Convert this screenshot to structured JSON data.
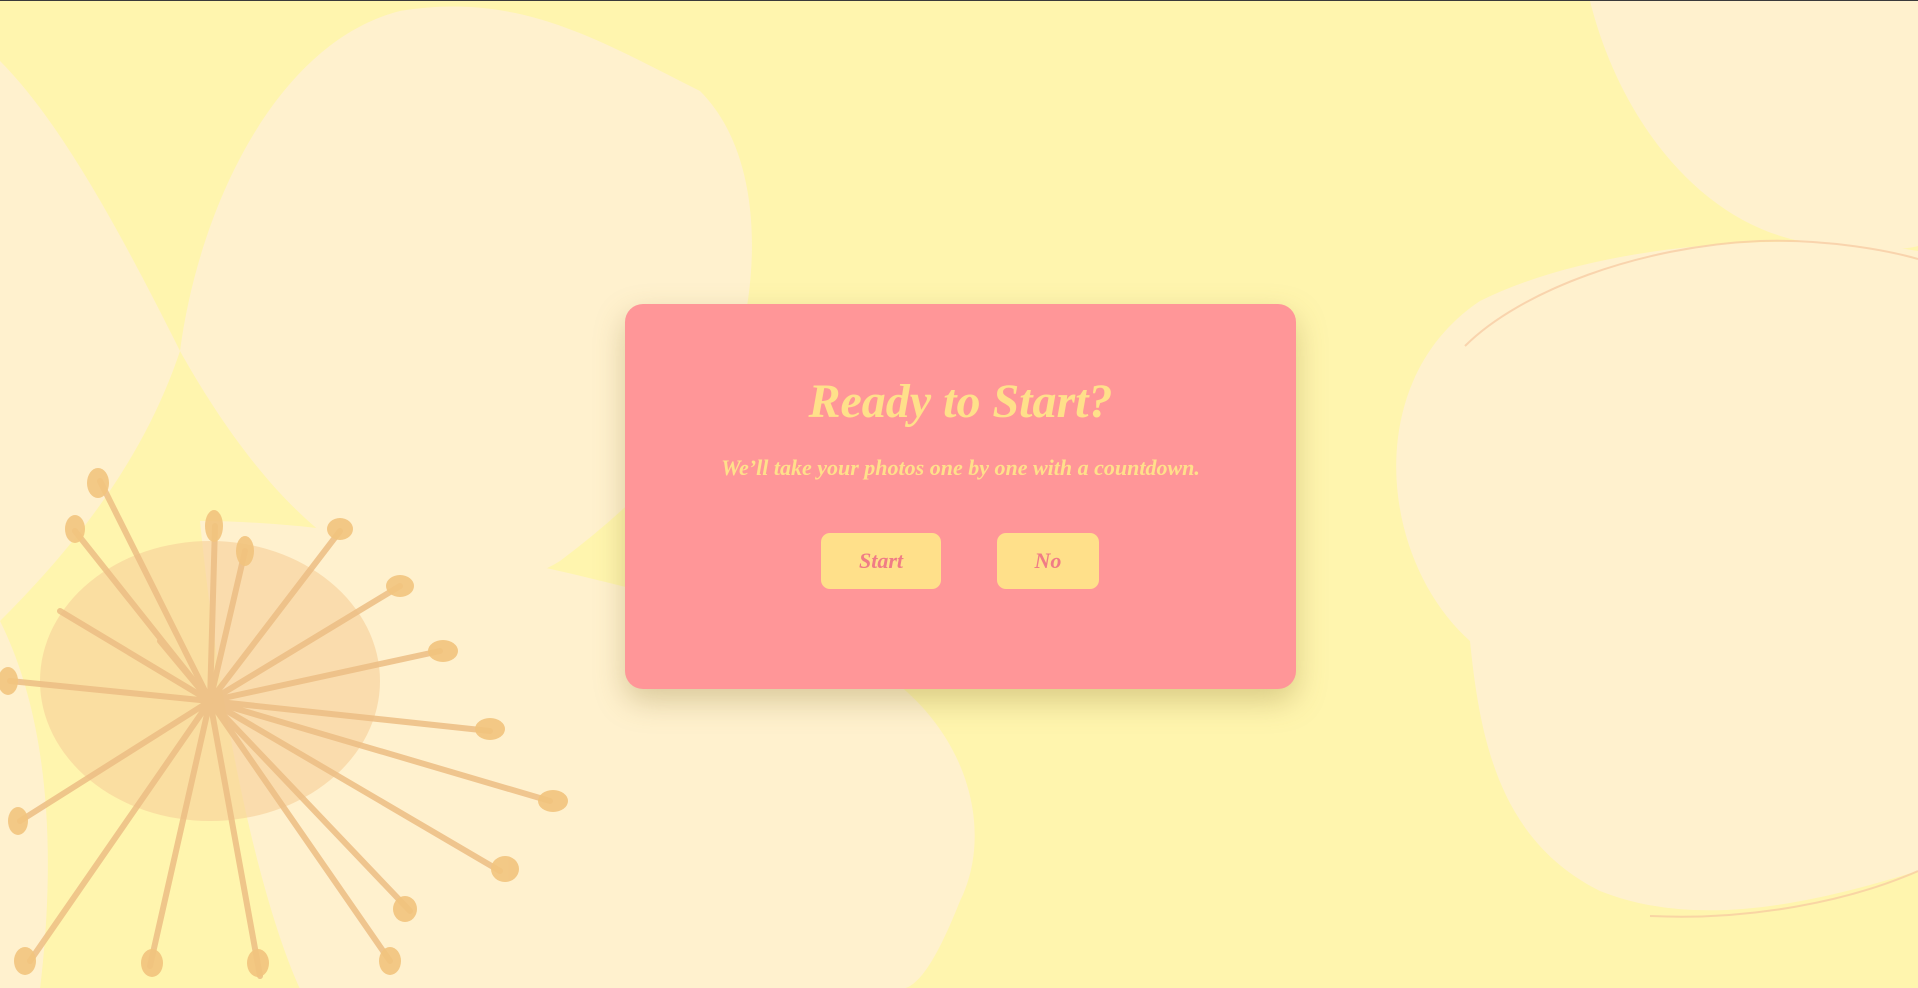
{
  "dialog": {
    "title": "Ready to Start?",
    "subtitle": "We’ll take your photos one by one with a countdown.",
    "start_label": "Start",
    "no_label": "No"
  },
  "colors": {
    "background": "#FFF5AE",
    "dialog_background": "#FF9698",
    "accent_yellow": "#FFE08A",
    "button_text": "#F07C86",
    "petal": "#FFF1D2",
    "stamen": "#F2C47E"
  }
}
